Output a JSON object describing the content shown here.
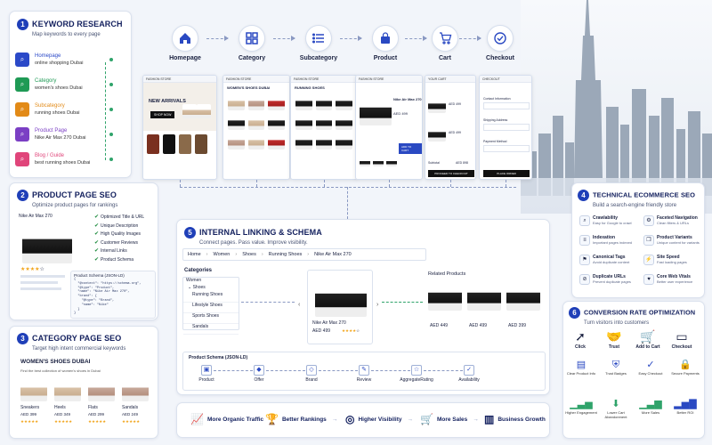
{
  "flow": {
    "steps": [
      "Homepage",
      "Category",
      "Subcategory",
      "Product",
      "Cart",
      "Checkout"
    ],
    "icons": [
      "home-icon",
      "grid-icon",
      "list-icon",
      "bag-icon",
      "cart-icon",
      "check-circle-icon"
    ]
  },
  "screens": {
    "home": {
      "brand": "FASHION STORE",
      "headline": "NEW ARRIVALS",
      "btn": "SHOP NOW"
    },
    "category": {
      "brand": "FASHION STORE",
      "title": "WOMEN'S SHOES DUBAI"
    },
    "subcategory": {
      "brand": "FASHION STORE",
      "title": "RUNNING SHOES"
    },
    "product": {
      "brand": "FASHION STORE",
      "name": "Nike Air Max 270",
      "price": "AED 499",
      "btn": "ADD TO CART"
    },
    "cart": {
      "title": "YOUR CART",
      "prices": [
        "AED 499",
        "AED 499"
      ],
      "subtotal_label": "Subtotal",
      "subtotal": "AED 898",
      "btn": "PROCEED TO CHECKOUT"
    },
    "checkout": {
      "title": "CHECKOUT",
      "fields": [
        "Contact Information",
        "Shipping Address",
        "Payment Method"
      ],
      "btn": "PLACE ORDER"
    }
  },
  "keyword": {
    "num": "1",
    "title": "KEYWORD RESEARCH",
    "subtitle": "Map keywords to every page",
    "items": [
      {
        "label": "Homepage",
        "value": "online shopping Dubai",
        "color": "#2b49c8",
        "icon": "search-icon"
      },
      {
        "label": "Category",
        "value": "women's shoes Dubai",
        "color": "#1f9a55",
        "icon": "search-icon"
      },
      {
        "label": "Subcategory",
        "value": "running shoes Dubai",
        "color": "#e28a17",
        "icon": "search-icon"
      },
      {
        "label": "Product Page",
        "value": "Nike Air Max 270 Dubai",
        "color": "#7b3fc4",
        "icon": "search-icon"
      },
      {
        "label": "Blog / Guide",
        "value": "best running shoes Dubai",
        "color": "#e0457a",
        "icon": "search-icon"
      }
    ]
  },
  "product_seo": {
    "num": "2",
    "title": "PRODUCT PAGE SEO",
    "subtitle": "Optimize product pages for rankings",
    "product_name": "Nike Air Max 270",
    "checks": [
      "Optimized Title & URL",
      "Unique Description",
      "High Quality Images",
      "Customer Reviews",
      "Internal Links",
      "Product Schema"
    ],
    "schema_title": "Product Schema (JSON-LD)",
    "schema_lines": [
      "{",
      "  \"@context\": \"https://schema.org\",",
      "  \"@type\": \"Product\",",
      "  \"name\": \"Nike Air Max 270\",",
      "  \"brand\": {",
      "    \"@type\": \"Brand\",",
      "    \"name\": \"Nike\"",
      "  }",
      "}"
    ]
  },
  "category_seo": {
    "num": "3",
    "title": "CATEGORY PAGE SEO",
    "subtitle": "Target high intent commercial keywords",
    "heading": "WOMEN'S SHOES DUBAI",
    "intro": "Find the best collection of women's shoes in Dubai",
    "products": [
      {
        "name": "Sneakers",
        "price": "AED 399"
      },
      {
        "name": "Heels",
        "price": "AED 349"
      },
      {
        "name": "Flats",
        "price": "AED 299"
      },
      {
        "name": "Sandals",
        "price": "AED 249"
      }
    ]
  },
  "internal": {
    "num": "5",
    "title": "INTERNAL LINKING & SCHEMA",
    "subtitle": "Connect pages. Pass value. Improve visibility.",
    "breadcrumb": [
      "Home",
      "Women",
      "Shoes",
      "Running Shoes",
      "Nike Air Max 270"
    ],
    "categories_title": "Categories",
    "categories": [
      "Women",
      "Shoes",
      "Running Shoes",
      "Lifestyle Shoes",
      "Sports Shoes",
      "Sandals"
    ],
    "product_name": "Nike Air Max 270",
    "product_price": "AED 499",
    "related_title": "Related Products",
    "related_prices": [
      "AED 449",
      "AED 499",
      "AED 399"
    ],
    "schema_title": "Product Schema (JSON-LD)",
    "schema_items": [
      "Product",
      "Offer",
      "Brand",
      "Review",
      "AggregateRating",
      "Availability"
    ]
  },
  "technical": {
    "num": "4",
    "title": "TECHNICAL ECOMMERCE SEO",
    "subtitle": "Build a search-engine friendly store",
    "items": [
      {
        "a": "Crawlability",
        "b": "Easy for Google to crawl"
      },
      {
        "a": "Faceted Navigation",
        "b": "Clean filters & URLs"
      },
      {
        "a": "Indexation",
        "b": "Important pages indexed"
      },
      {
        "a": "Product Variants",
        "b": "Unique content for variants"
      },
      {
        "a": "Canonical Tags",
        "b": "Avoid duplicate content"
      },
      {
        "a": "Site Speed",
        "b": "Fast loading pages"
      },
      {
        "a": "Duplicate URLs",
        "b": "Prevent duplicate pages"
      },
      {
        "a": "Core Web Vitals",
        "b": "Better user experience"
      }
    ]
  },
  "conversion": {
    "num": "6",
    "title": "CONVERSION RATE OPTIMIZATION",
    "subtitle": "Turn visitors into customers",
    "steps": [
      "Click",
      "Trust",
      "Add to Cart",
      "Checkout"
    ],
    "features": [
      "Clear Product Info",
      "Trust Badges",
      "Easy Checkout",
      "Secure Payments"
    ],
    "results": [
      "Higher Engagement",
      "Lower Cart Abandonment",
      "More Sales",
      "Better ROI"
    ]
  },
  "benefits": [
    "More Organic Traffic",
    "Better Rankings",
    "Higher Visibility",
    "More Sales",
    "Business Growth"
  ],
  "colors": {
    "primary": "#1f3fb8",
    "navy": "#13205e",
    "accent_green": "#2fa36a",
    "background": "#f2f5fa"
  }
}
